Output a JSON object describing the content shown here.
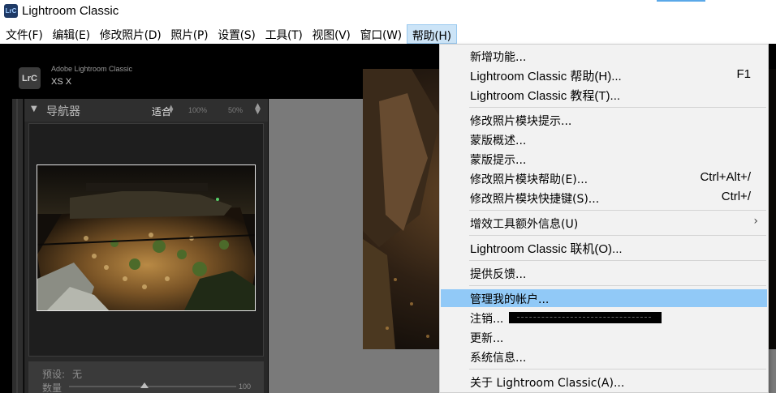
{
  "window": {
    "title": "Lightroom Classic",
    "logo_text": "LrC"
  },
  "menubar": [
    {
      "label": "文件(F)"
    },
    {
      "label": "编辑(E)"
    },
    {
      "label": "修改照片(D)"
    },
    {
      "label": "照片(P)"
    },
    {
      "label": "设置(S)"
    },
    {
      "label": "工具(T)"
    },
    {
      "label": "视图(V)"
    },
    {
      "label": "窗口(W)"
    },
    {
      "label": "帮助(H)"
    }
  ],
  "identity": {
    "badge": "LrC",
    "product": "Adobe Lightroom Classic",
    "user": "XS X"
  },
  "navigator": {
    "title": "导航器",
    "zoom_fit": "适合",
    "zoom_100": "100%",
    "zoom_50": "50%",
    "preset_label": "预设:",
    "preset_value": "无",
    "quantity_label": "数量",
    "quantity_value": "100",
    "quantity_level_percent": 45
  },
  "help_menu": {
    "items": [
      {
        "label": "新增功能..."
      },
      {
        "label": "Lightroom Classic 帮助(H)...",
        "shortcut": "F1"
      },
      {
        "label": "Lightroom Classic 教程(T)..."
      },
      {
        "label": "修改照片模块提示..."
      },
      {
        "label": "蒙版概述..."
      },
      {
        "label": "蒙版提示..."
      },
      {
        "label": "修改照片模块帮助(E)...",
        "shortcut": "Ctrl+Alt+/"
      },
      {
        "label": "修改照片模块快捷键(S)...",
        "shortcut": "Ctrl+/"
      },
      {
        "label": "增效工具额外信息(U)",
        "submenu": "›"
      },
      {
        "label": "Lightroom Classic 联机(O)..."
      },
      {
        "label": "提供反馈..."
      },
      {
        "label": "管理我的帐户..."
      },
      {
        "label": "注销..."
      },
      {
        "label": "更新..."
      },
      {
        "label": "系统信息..."
      },
      {
        "label": "关于 Lightroom Classic(A)..."
      }
    ],
    "highlighted_item": "管理我的帐户..."
  },
  "colors": {
    "menu_highlight": "#91c9f7",
    "menubar_active": "#cce4f7",
    "panel_background": "#282828",
    "canvas_gray": "#7a7a7a"
  }
}
